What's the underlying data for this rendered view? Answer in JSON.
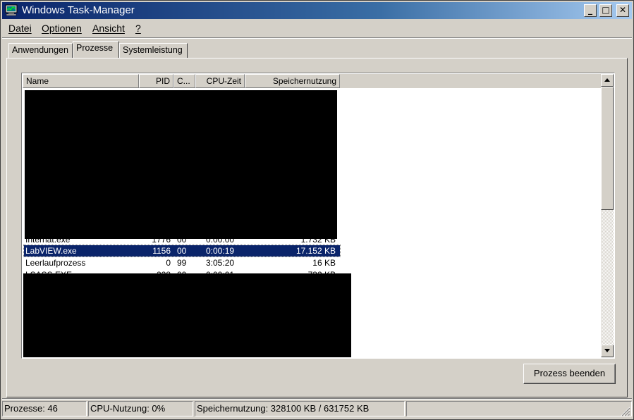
{
  "window": {
    "title": "Windows Task-Manager",
    "minimize_glyph": "_",
    "maximize_glyph": "□",
    "close_glyph": "✕"
  },
  "menu": [
    "Datei",
    "Optionen",
    "Ansicht",
    "?"
  ],
  "tabs": [
    {
      "label": "Anwendungen",
      "active": false
    },
    {
      "label": "Prozesse",
      "active": true
    },
    {
      "label": "Systemleistung",
      "active": false
    }
  ],
  "columns": [
    "Name",
    "PID",
    "C...",
    "CPU-Zeit",
    "Speichernutzung"
  ],
  "processes": [
    {
      "name": "Internat.exe",
      "pid": "1776",
      "cpu": "00",
      "cpu_time": "0:00:00",
      "memory": "1.732 KB",
      "partially_hidden": true
    },
    {
      "name": "LabVIEW.exe",
      "pid": "1156",
      "cpu": "00",
      "cpu_time": "0:00:19",
      "memory": "17.152 KB",
      "selected": true
    },
    {
      "name": "Leerlaufprozess",
      "pid": "0",
      "cpu": "99",
      "cpu_time": "3:05:20",
      "memory": "16 KB"
    },
    {
      "name": "LSASS.EXE",
      "pid": "228",
      "cpu": "00",
      "cpu_time": "0:00:01",
      "memory": "732 KB",
      "partially_hidden": true
    }
  ],
  "end_process_button": "Prozess beenden",
  "statusbar": {
    "processes": "Prozesse: 46",
    "cpu": "CPU-Nutzung: 0%",
    "memory": "Speichernutzung: 328100 KB / 631752 KB"
  },
  "colors": {
    "selection": "#0a246a",
    "titlebar_start": "#0a246a",
    "titlebar_end": "#a6caf0",
    "face": "#d4d0c8"
  },
  "icons": {
    "app": "task-manager-icon",
    "scroll_up": "scroll-up-arrow-icon",
    "scroll_down": "scroll-down-arrow-icon",
    "grip": "resize-grip-icon"
  }
}
